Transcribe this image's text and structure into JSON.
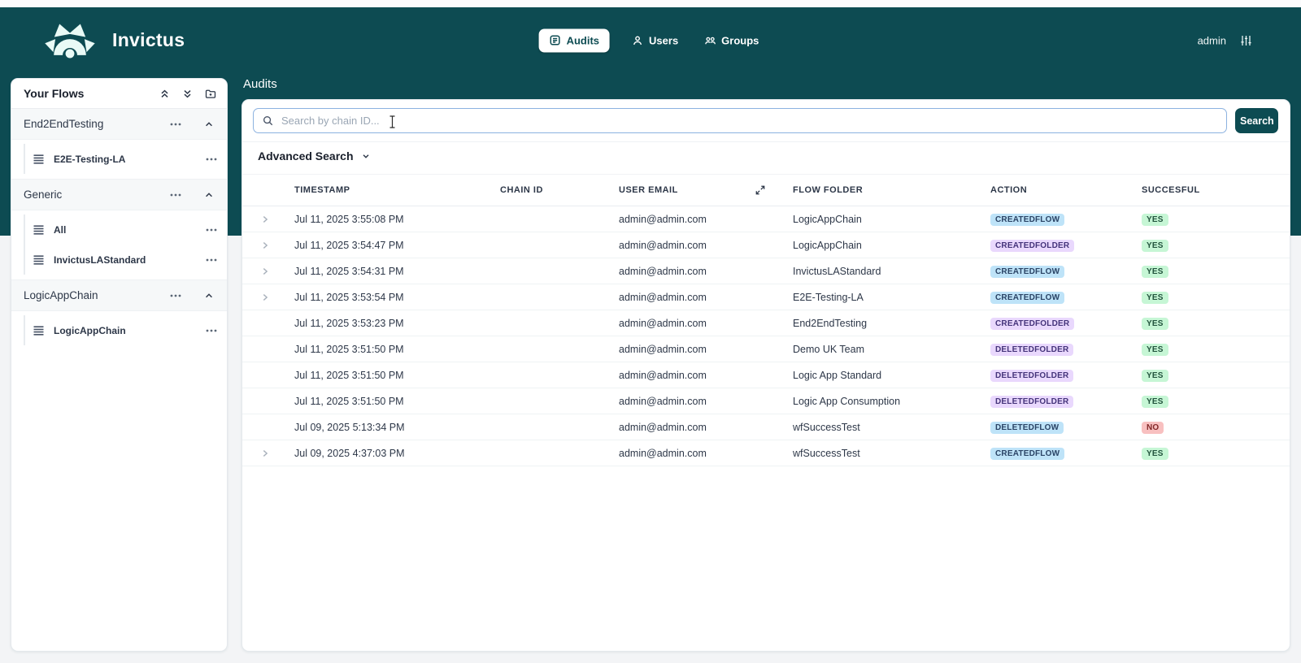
{
  "brand": {
    "name": "Invictus"
  },
  "header": {
    "nav": [
      {
        "label": "Audits",
        "active": true
      },
      {
        "label": "Users",
        "active": false
      },
      {
        "label": "Groups",
        "active": false
      }
    ],
    "user": "admin"
  },
  "sidebar": {
    "title": "Your Flows",
    "groups": [
      {
        "name": "End2EndTesting",
        "expanded": true,
        "items": [
          "E2E-Testing-LA"
        ]
      },
      {
        "name": "Generic",
        "expanded": true,
        "items": [
          "All",
          "InvictusLAStandard"
        ]
      },
      {
        "name": "LogicAppChain",
        "expanded": true,
        "items": [
          "LogicAppChain"
        ]
      }
    ]
  },
  "main": {
    "title": "Audits",
    "search": {
      "placeholder": "Search by chain ID...",
      "value": "",
      "button": "Search"
    },
    "advanced_search_label": "Advanced Search",
    "table": {
      "columns": [
        "TIMESTAMP",
        "CHAIN ID",
        "USER EMAIL",
        "FLOW FOLDER",
        "ACTION",
        "SUCCESFUL"
      ],
      "rows": [
        {
          "expandable": true,
          "timestamp": "Jul 11, 2025 3:55:08 PM",
          "chain_id": "",
          "user_email": "admin@admin.com",
          "flow_folder": "LogicAppChain",
          "action": "CREATEDFLOW",
          "action_color": "blue",
          "succesful": "YES",
          "succesful_color": "green"
        },
        {
          "expandable": true,
          "timestamp": "Jul 11, 2025 3:54:47 PM",
          "chain_id": "",
          "user_email": "admin@admin.com",
          "flow_folder": "LogicAppChain",
          "action": "CREATEDFOLDER",
          "action_color": "purple",
          "succesful": "YES",
          "succesful_color": "green"
        },
        {
          "expandable": true,
          "timestamp": "Jul 11, 2025 3:54:31 PM",
          "chain_id": "",
          "user_email": "admin@admin.com",
          "flow_folder": "InvictusLAStandard",
          "action": "CREATEDFLOW",
          "action_color": "blue",
          "succesful": "YES",
          "succesful_color": "green"
        },
        {
          "expandable": true,
          "timestamp": "Jul 11, 2025 3:53:54 PM",
          "chain_id": "",
          "user_email": "admin@admin.com",
          "flow_folder": "E2E-Testing-LA",
          "action": "CREATEDFLOW",
          "action_color": "blue",
          "succesful": "YES",
          "succesful_color": "green"
        },
        {
          "expandable": false,
          "timestamp": "Jul 11, 2025 3:53:23 PM",
          "chain_id": "",
          "user_email": "admin@admin.com",
          "flow_folder": "End2EndTesting",
          "action": "CREATEDFOLDER",
          "action_color": "purple",
          "succesful": "YES",
          "succesful_color": "green"
        },
        {
          "expandable": false,
          "timestamp": "Jul 11, 2025 3:51:50 PM",
          "chain_id": "",
          "user_email": "admin@admin.com",
          "flow_folder": "Demo UK Team",
          "action": "DELETEDFOLDER",
          "action_color": "purple",
          "succesful": "YES",
          "succesful_color": "green"
        },
        {
          "expandable": false,
          "timestamp": "Jul 11, 2025 3:51:50 PM",
          "chain_id": "",
          "user_email": "admin@admin.com",
          "flow_folder": "Logic App Standard",
          "action": "DELETEDFOLDER",
          "action_color": "purple",
          "succesful": "YES",
          "succesful_color": "green"
        },
        {
          "expandable": false,
          "timestamp": "Jul 11, 2025 3:51:50 PM",
          "chain_id": "",
          "user_email": "admin@admin.com",
          "flow_folder": "Logic App Consumption",
          "action": "DELETEDFOLDER",
          "action_color": "purple",
          "succesful": "YES",
          "succesful_color": "green"
        },
        {
          "expandable": false,
          "timestamp": "Jul 09, 2025 5:13:34 PM",
          "chain_id": "",
          "user_email": "admin@admin.com",
          "flow_folder": "wfSuccessTest",
          "action": "DELETEDFLOW",
          "action_color": "blue",
          "succesful": "NO",
          "succesful_color": "red"
        },
        {
          "expandable": true,
          "timestamp": "Jul 09, 2025 4:37:03 PM",
          "chain_id": "",
          "user_email": "admin@admin.com",
          "flow_folder": "wfSuccessTest",
          "action": "CREATEDFLOW",
          "action_color": "blue",
          "succesful": "YES",
          "succesful_color": "green"
        }
      ]
    }
  },
  "icons": {
    "logo": "invictus-star-logo",
    "nav_audits": "audit-log-icon",
    "nav_users": "person-icon",
    "nav_groups": "people-group-icon",
    "header_settings": "vertical-sliders-icon",
    "sidebar_tools": [
      "collapse-all-icon",
      "expand-all-icon",
      "add-folder-icon"
    ],
    "flow_item": "stack-icon",
    "search": "magnifier-icon",
    "sort": "diagonal-arrows-icon"
  },
  "colors": {
    "teal": "#0d4b52",
    "badge_blue_bg": "#bee3f8",
    "badge_purple_bg": "#e9d8fd",
    "badge_green_bg": "#c6f6d5",
    "badge_red_bg": "#f8c0c0",
    "search_border": "#8cb2e0"
  }
}
